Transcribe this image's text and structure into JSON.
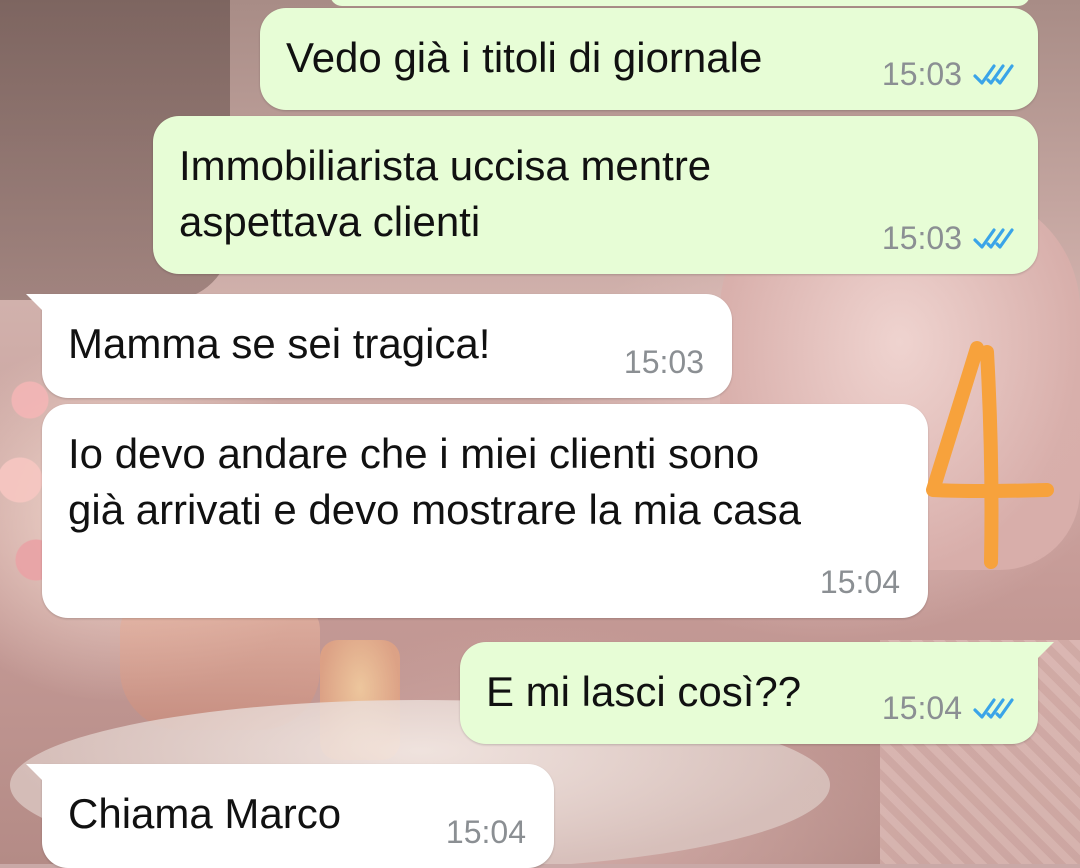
{
  "colors": {
    "outgoing_bubble": "#e7fdd6",
    "incoming_bubble": "#ffffff",
    "read_ticks": "#3aa4e8",
    "timestamp": "#8b8f93",
    "annotation": "#f7a23c"
  },
  "messages": [
    {
      "direction": "outgoing",
      "text": "Vedo già i titoli di giornale",
      "time": "15:03",
      "status": "read",
      "status_icon": "double-check-icon"
    },
    {
      "direction": "outgoing",
      "text": "Immobiliarista uccisa mentre\naspettava clienti",
      "time": "15:03",
      "status": "read",
      "status_icon": "double-check-icon"
    },
    {
      "direction": "incoming",
      "text": "Mamma se sei tragica!",
      "time": "15:03"
    },
    {
      "direction": "incoming",
      "text": "Io devo andare che i miei clienti sono\ngià arrivati e devo mostrare la mia casa",
      "time": "15:04"
    },
    {
      "direction": "outgoing",
      "text": "E mi lasci così??",
      "time": "15:04",
      "status": "read",
      "status_icon": "double-check-icon"
    },
    {
      "direction": "incoming",
      "text": "Chiama Marco",
      "time": "15:04"
    }
  ],
  "annotation": {
    "text": "4",
    "style": "handwritten"
  }
}
